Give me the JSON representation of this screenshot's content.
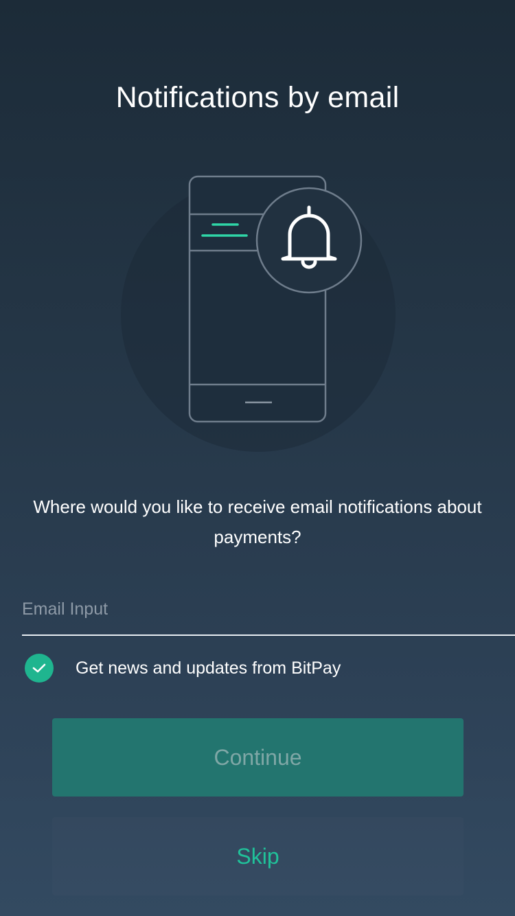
{
  "header": {
    "title": "Notifications by email"
  },
  "illustration": {
    "icons": [
      "phone-icon",
      "bell-icon"
    ],
    "accent_color": "#2fd5a7"
  },
  "prompt": {
    "question": "Where would you like to receive email notifications about payments?"
  },
  "form": {
    "email_placeholder": "Email Input",
    "email_value": "",
    "newsletter_checked": true,
    "newsletter_label": "Get news and updates from BitPay",
    "checkbox_color": "#1fb58f"
  },
  "actions": {
    "continue_label": "Continue",
    "skip_label": "Skip",
    "continue_color": "#23756f",
    "skip_color": "#20c29a"
  }
}
